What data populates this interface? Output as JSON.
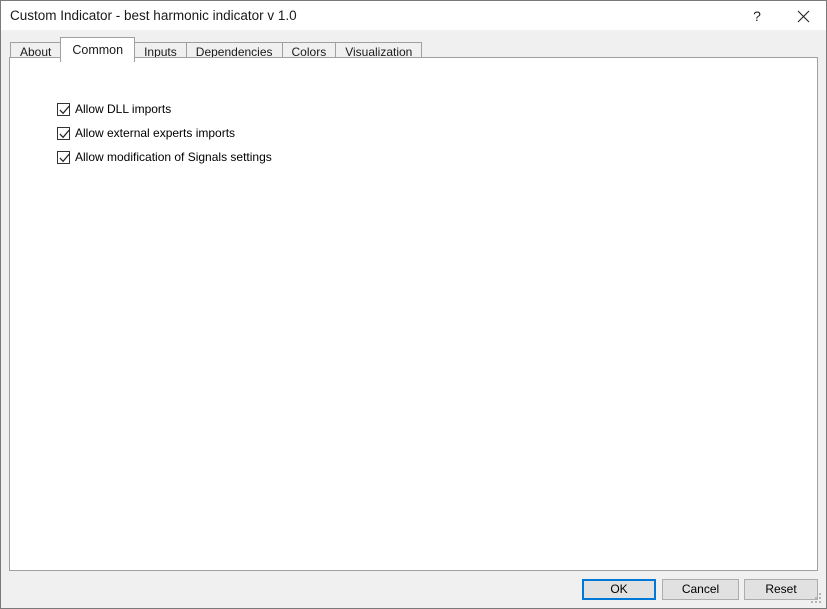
{
  "window": {
    "title": "Custom Indicator - best harmonic indicator v 1.0",
    "help_label": "?",
    "close_label": "✕",
    "accent_color": "#0078d7",
    "titlebar_bg": "#ffffff",
    "chrome_bg": "#f0f0f0",
    "panel_bg": "#ffffff"
  },
  "tabs": [
    {
      "label": "About",
      "active": false
    },
    {
      "label": "Common",
      "active": true
    },
    {
      "label": "Inputs",
      "active": false
    },
    {
      "label": "Dependencies",
      "active": false
    },
    {
      "label": "Colors",
      "active": false
    },
    {
      "label": "Visualization",
      "active": false
    }
  ],
  "common_tab": {
    "checkboxes": [
      {
        "label": "Allow DLL imports",
        "checked": true
      },
      {
        "label": "Allow external experts imports",
        "checked": true
      },
      {
        "label": "Allow modification of Signals settings",
        "checked": true
      }
    ]
  },
  "footer": {
    "ok_label": "OK",
    "cancel_label": "Cancel",
    "reset_label": "Reset"
  }
}
